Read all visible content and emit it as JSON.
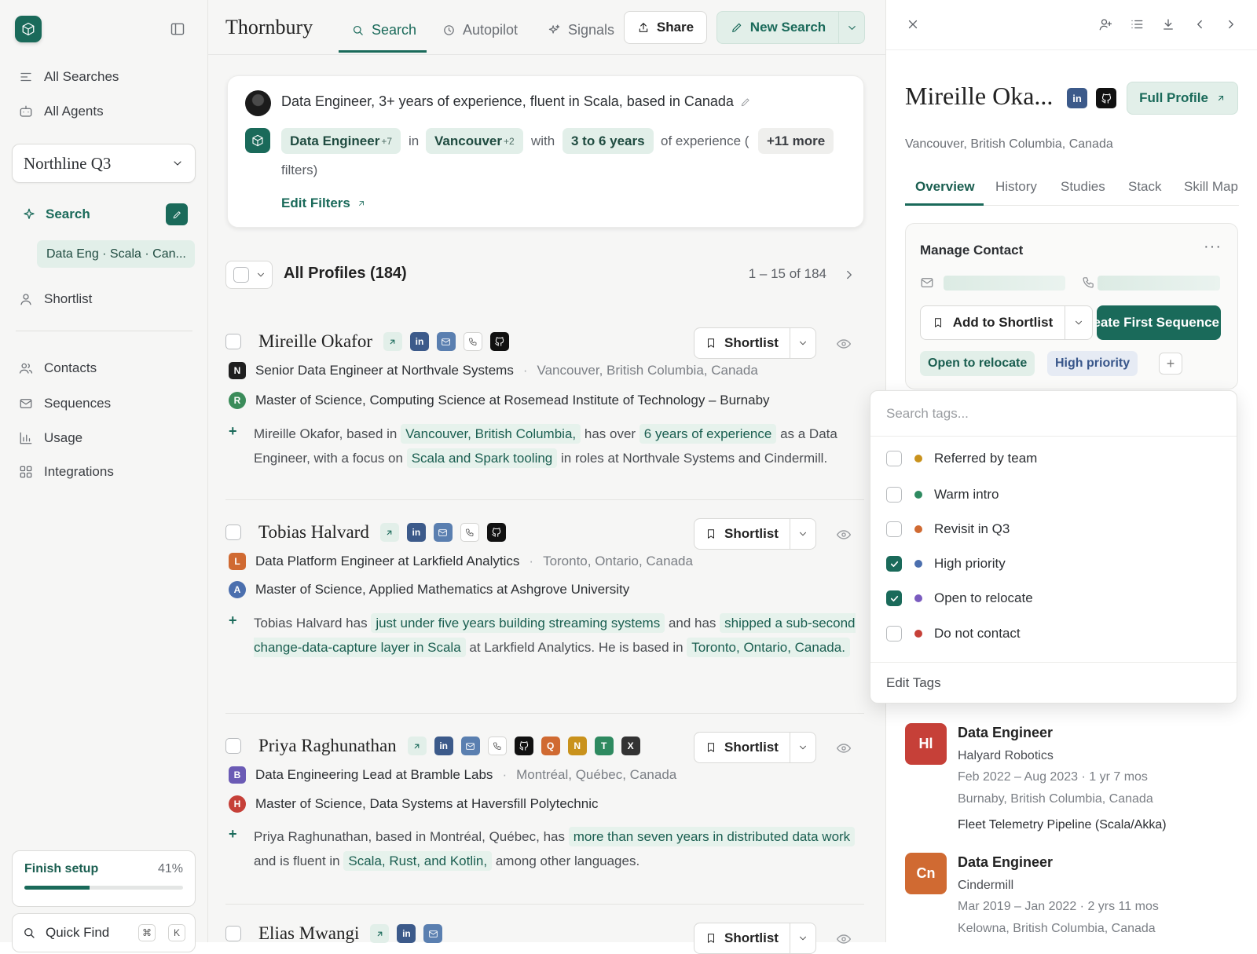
{
  "sidebar": {
    "nav_top": [
      {
        "label": "All Searches",
        "icon": "list-icon"
      },
      {
        "label": "All Agents",
        "icon": "agent-icon"
      }
    ],
    "workspace": "Northline Q3",
    "search_label": "Search",
    "saved_search": "Data Eng · Scala · Can...",
    "shortlist_label": "Shortlist",
    "nav_bottom": [
      {
        "label": "Contacts"
      },
      {
        "label": "Sequences"
      },
      {
        "label": "Usage"
      },
      {
        "label": "Integrations"
      }
    ],
    "setup": {
      "label": "Finish setup",
      "percent_text": "41%",
      "progress": 0.41
    },
    "quick_find": {
      "label": "Quick Find",
      "key1": "⌘",
      "key2": "K"
    }
  },
  "header": {
    "brand": "Thornbury",
    "tabs": [
      {
        "label": "Search"
      },
      {
        "label": "Autopilot"
      },
      {
        "label": "Signals"
      }
    ],
    "share": "Share",
    "new_search": "New Search"
  },
  "query": {
    "text": "Data Engineer, 3+ years of experience, fluent in Scala, based in Canada",
    "chip_role": "Data Engineer",
    "chip_role_more": "+7",
    "word_in": "in",
    "chip_loc": "Vancouver",
    "chip_loc_more": "+2",
    "word_with": "with",
    "chip_years": "3 to 6 years",
    "word_exp": "of experience (",
    "chip_more": "+11 more",
    "word_filters": "filters)",
    "edit_filters": "Edit Filters"
  },
  "list": {
    "title": "All Profiles (184)",
    "pagination": "1 – 15 of 184"
  },
  "profiles": [
    {
      "name": "Mireille Okafor",
      "shortlist": "Shortlist",
      "role_badge": "N",
      "role_color": "#1f1f1f",
      "role": "Senior Data Engineer at Northvale Systems",
      "location": "Vancouver, British Columbia, Canada",
      "edu_badge": "R",
      "edu_color": "#3b8c5a",
      "edu": "Master of Science, Computing Science at Rosemead Institute of Technology – Burnaby",
      "s1": "Mireille Okafor, based in",
      "h1": "Vancouver, British Columbia,",
      "s2": "has over",
      "h2": "6 years of experience",
      "s3": "as a Data Engineer, with a focus on",
      "h3": "Scala and Spark tooling",
      "s4": "in roles at Northvale Systems and Cindermill."
    },
    {
      "name": "Tobias Halvard",
      "shortlist": "Shortlist",
      "role_badge": "L",
      "role_color": "#d06a32",
      "role": "Data Platform Engineer at Larkfield Analytics",
      "location": "Toronto, Ontario, Canada",
      "edu_badge": "A",
      "edu_color": "#4b6fae",
      "edu": "Master of Science, Applied Mathematics at Ashgrove University",
      "s1": "Tobias Halvard has",
      "h1": "just under five years building streaming systems",
      "s2": "and has",
      "h2": "shipped a sub-second change-data-capture layer in Scala",
      "s3": "at Larkfield Analytics. He is based in",
      "h3": "Toronto, Ontario, Canada.",
      "s4": ""
    },
    {
      "name": "Priya Raghunathan",
      "shortlist": "Shortlist",
      "role_badge": "B",
      "role_color": "#6b5bb5",
      "role": "Data Engineering Lead at Bramble Labs",
      "location": "Montréal, Québec, Canada",
      "edu_badge": "H",
      "edu_color": "#c64038",
      "edu": "Master of Science, Data Systems at Haversfill Polytechnic",
      "s1": "Priya Raghunathan, based in Montréal, Québec, has",
      "h1": "more than seven years in distributed data work",
      "s2": "and is fluent in",
      "h2": "Scala, Rust, and Kotlin,",
      "s3": "among other languages.",
      "h3": "",
      "s4": ""
    },
    {
      "name": "Elias Mwangi",
      "shortlist": "Shortlist"
    }
  ],
  "panel": {
    "name": "Mireille Oka...",
    "full_profile": "Full Profile",
    "location": "Vancouver, British Columbia, Canada",
    "tabs": [
      "Overview",
      "History",
      "Studies",
      "Stack",
      "Skill Map"
    ],
    "manage_contact": "Manage Contact",
    "add_to_shortlist": "Add to Shortlist",
    "create_sequence": "Create First Sequence",
    "tags": [
      "Open to relocate",
      "High priority"
    ],
    "experience": [
      {
        "logo": "Hl",
        "color": "#c64038",
        "title": "Data Engineer",
        "company": "Halyard Robotics",
        "dates": "Feb 2022 – Aug 2023 · 1 yr 7 mos",
        "location": "Burnaby, British Columbia, Canada",
        "project": "Fleet Telemetry Pipeline (Scala/Akka)"
      },
      {
        "logo": "Cn",
        "color": "#d06a32",
        "title": "Data Engineer",
        "company": "Cindermill",
        "dates": "Mar 2019 – Jan 2022 · 2 yrs 11 mos",
        "location": "Kelowna, British Columbia, Canada"
      }
    ]
  },
  "tag_dropdown": {
    "placeholder": "Search tags...",
    "items": [
      {
        "label": "Referred by team",
        "color": "#c9921c",
        "checked": false
      },
      {
        "label": "Warm intro",
        "color": "#2e8a60",
        "checked": false
      },
      {
        "label": "Revisit in Q3",
        "color": "#d06a32",
        "checked": false
      },
      {
        "label": "High priority",
        "color": "#4b6fae",
        "checked": true
      },
      {
        "label": "Open to relocate",
        "color": "#7a5bbf",
        "checked": true
      },
      {
        "label": "Do not contact",
        "color": "#c64038",
        "checked": false
      }
    ],
    "edit": "Edit Tags"
  },
  "colors": {
    "accent": "#1a6a5a",
    "accent_light": "#e2efe9"
  }
}
